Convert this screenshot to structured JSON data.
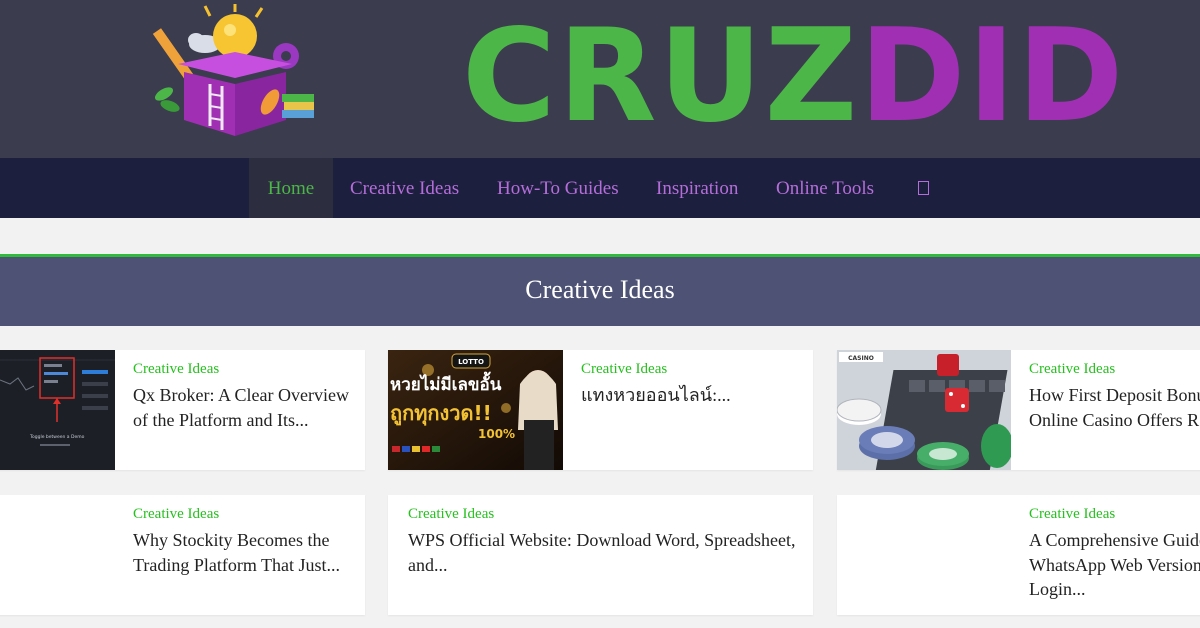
{
  "site": {
    "logo_part_a": "CRUZ",
    "logo_part_b": "DID",
    "logo_icon": "lightbulb-box-icon",
    "colors": {
      "header": "#3b3c4e",
      "nav": "#1d1f3f",
      "green": "#4cb648",
      "purple": "#a02fb4",
      "banner": "#4e5375"
    }
  },
  "nav": {
    "items": [
      {
        "label": "Home",
        "active": true
      },
      {
        "label": "Creative Ideas"
      },
      {
        "label": "How-To Guides"
      },
      {
        "label": "Inspiration"
      },
      {
        "label": "Online Tools"
      }
    ],
    "search_icon": "search-icon"
  },
  "section": {
    "title": "Creative Ideas"
  },
  "posts": [
    {
      "category": "Creative Ideas",
      "title": "Qx Broker: A Clear Overview of the Platform and Its...",
      "thumb_caption": "Toggle between a Demo"
    },
    {
      "category": "Creative Ideas",
      "title": "แทงหวยออนไลน์:...",
      "thumb_brand": "LOTTO",
      "thumb_headline": "หวยไม่มีเลขอั้น",
      "thumb_headline2": "ถูกทุกงวด!!",
      "thumb_pct": "100%"
    },
    {
      "category": "Creative Ideas",
      "title": "How First Deposit Bonuses in Online Casino Offers R...",
      "thumb_brand": "CASINO"
    },
    {
      "category": "Creative Ideas",
      "title": "Why Stockity Becomes the Trading Platform That Just..."
    },
    {
      "category": "Creative Ideas",
      "title": "WPS Official Website: Download Word, Spreadsheet, and..."
    },
    {
      "category": "Creative Ideas",
      "title": "A Comprehensive Guide to WhatsApp Web Version Login..."
    }
  ]
}
